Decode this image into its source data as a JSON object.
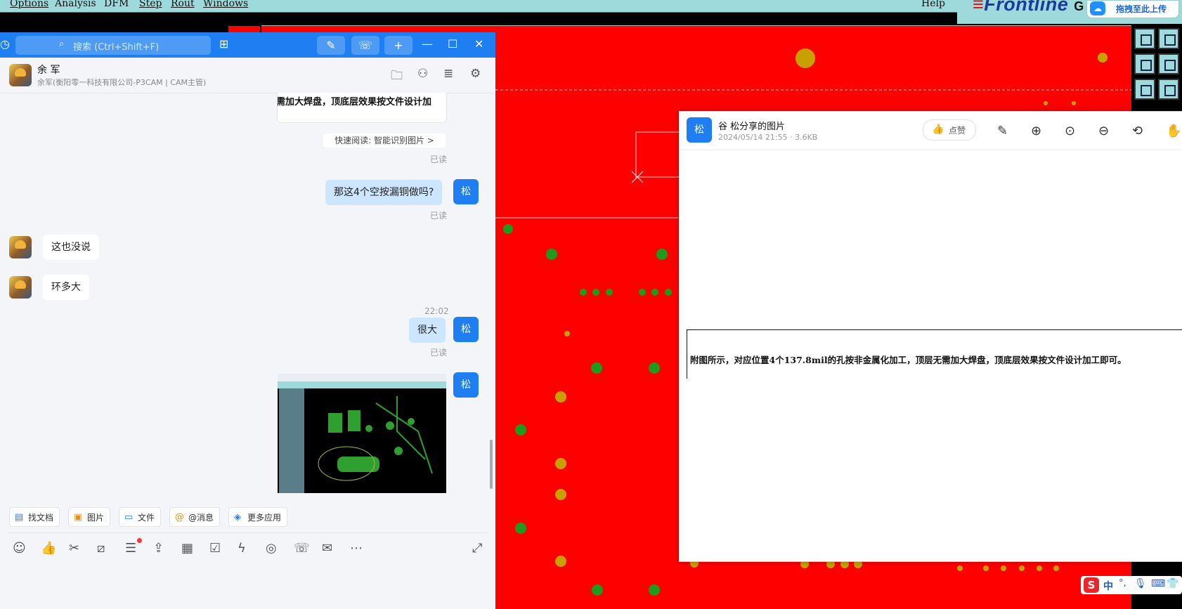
{
  "cam": {
    "menu": [
      "Options",
      "Analysis",
      "DFM",
      "Step",
      "Rout",
      "Windows"
    ],
    "help": "Help",
    "logo": "Frontline",
    "logo_suffix": "G",
    "upload_label": "拖拽至此上传",
    "accent": "#ff0000"
  },
  "chat": {
    "search_placeholder": "搜索 (Ctrl+Shift+F)",
    "contact_name": "余 军",
    "contact_sub": "余军(衡阳零一科技有限公司-P3CAM | CAM主管)",
    "quoted_text": "需加大焊盘，顶底层效果按文件设计加",
    "quick_read": "快速阅读: 智能识别图片 >",
    "read1": "已读",
    "msg_out1": "那这4个空按漏铜做吗?",
    "read2": "已读",
    "msg_in1": "这也没说",
    "msg_in2": "环多大",
    "time1": "22:02",
    "msg_out2": "很大",
    "read3": "已读",
    "me_label": "松",
    "chips": [
      "找文档",
      "图片",
      "文件",
      "@消息",
      "更多应用"
    ]
  },
  "viewer": {
    "avatar": "松",
    "title": "谷 松分享的图片",
    "meta": "2024/05/14 21:55 · 3.6KB",
    "like_label": "点赞",
    "body_text": "附图所示，对应位置4个137.8mil的孔按非金属化加工，顶层无需加大焊盘，顶底层效果按文件设计加工即可。"
  },
  "ime": {
    "label": "中"
  }
}
